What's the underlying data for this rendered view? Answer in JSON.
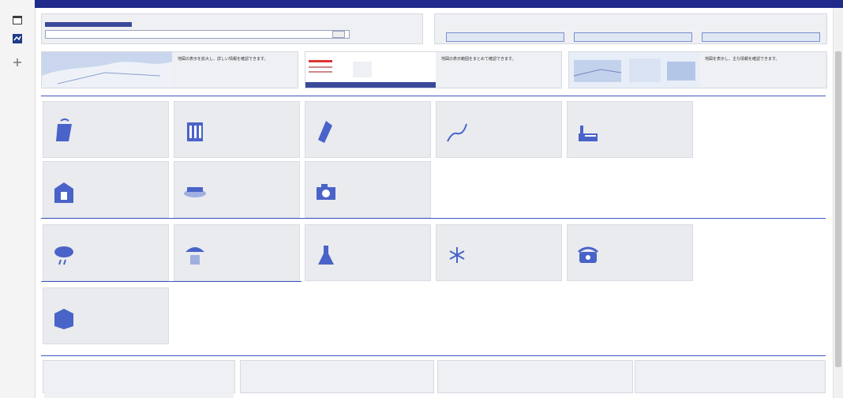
{
  "colors": {
    "accent": "#3f55c5",
    "topbar": "#1f2a8a",
    "icon": "#4a63c8"
  },
  "topbar": {
    "title": "",
    "right_text": ""
  },
  "sidebar": {
    "items": [
      {
        "icon": "calendar-icon"
      },
      {
        "icon": "map-icon"
      },
      {
        "icon": "plus-icon"
      }
    ]
  },
  "search": {
    "label": "",
    "value": "",
    "button": ""
  },
  "filter": {
    "label": "",
    "sublabel": "",
    "buttons": [
      "",
      "",
      ""
    ]
  },
  "map_cards": [
    {
      "desc": "地図の表示を拡大し、詳しい情報を確認できます。"
    },
    {
      "desc": "地図の表示範囲をまとめて確認できます。"
    },
    {
      "desc": "地図を表示し、主な情報を確認できます。"
    }
  ],
  "sections": [
    {
      "title": "",
      "cards": [
        {
          "tag": "",
          "desc": "",
          "icon": "plastic-bag-icon"
        },
        {
          "tag": "",
          "desc": "",
          "icon": "cup-icon"
        },
        {
          "tag": "",
          "desc": "",
          "icon": "bottle-icon"
        },
        {
          "tag": "",
          "desc": "",
          "icon": "wind-icon"
        },
        {
          "tag": "",
          "desc": "",
          "icon": "factory-icon"
        }
      ]
    },
    {
      "title": "",
      "cards": [
        {
          "tag": "",
          "desc": "",
          "icon": "building-icon"
        },
        {
          "tag": "",
          "desc": "",
          "icon": "dish-icon"
        },
        {
          "tag": "",
          "desc": "",
          "icon": "camera-icon"
        }
      ]
    },
    {
      "title": "",
      "cards": [
        {
          "tag": "",
          "desc": "",
          "icon": "cloud-icon"
        },
        {
          "tag": "",
          "desc": "",
          "icon": "umbrella-icon"
        },
        {
          "tag": "",
          "desc": "",
          "icon": "flask-icon"
        },
        {
          "tag": "",
          "desc": "",
          "icon": "snowflake-icon"
        },
        {
          "tag": "",
          "desc": "",
          "icon": "phone-icon"
        }
      ]
    },
    {
      "title": "",
      "cards": [
        {
          "tag": "",
          "desc": "",
          "icon": "box-icon"
        }
      ]
    }
  ],
  "links": {
    "title": "",
    "items": [
      {
        "title": "",
        "desc": ""
      },
      {
        "title": "",
        "desc": ""
      },
      {
        "title": "",
        "desc": ""
      },
      {
        "title": "",
        "desc": ""
      }
    ]
  },
  "footer": {
    "text": ""
  }
}
